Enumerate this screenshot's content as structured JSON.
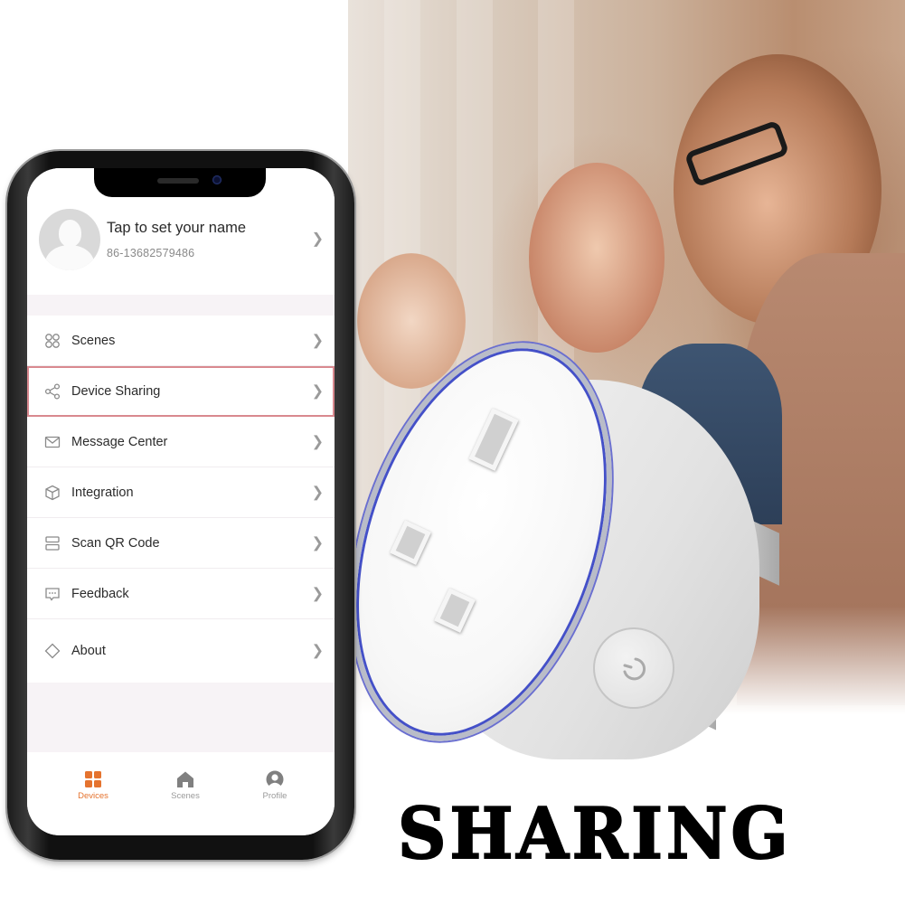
{
  "profile": {
    "name_prompt": "Tap to set your name",
    "phone_number": "86-13682579486"
  },
  "menu": {
    "items": [
      {
        "label": "Scenes",
        "icon": "scenes-grid-icon",
        "active": false
      },
      {
        "label": "Device Sharing",
        "icon": "share-icon",
        "active": true
      },
      {
        "label": "Message Center",
        "icon": "envelope-icon",
        "active": false
      },
      {
        "label": "Integration",
        "icon": "cube-icon",
        "active": false
      },
      {
        "label": "Scan QR Code",
        "icon": "scan-icon",
        "active": false
      },
      {
        "label": "Feedback",
        "icon": "chat-bubble-icon",
        "active": false
      },
      {
        "label": "About",
        "icon": "diamond-icon",
        "active": false
      }
    ]
  },
  "tabbar": {
    "tabs": [
      {
        "label": "Devices",
        "icon": "devices-grid-icon",
        "active": true
      },
      {
        "label": "Scenes",
        "icon": "home-icon",
        "active": false
      },
      {
        "label": "Profile",
        "icon": "profile-icon",
        "active": false
      }
    ]
  },
  "colors": {
    "accent": "#e5732e",
    "highlight_border": "#d9898f",
    "led_ring": "#4450c8"
  },
  "headline": "SHARING"
}
